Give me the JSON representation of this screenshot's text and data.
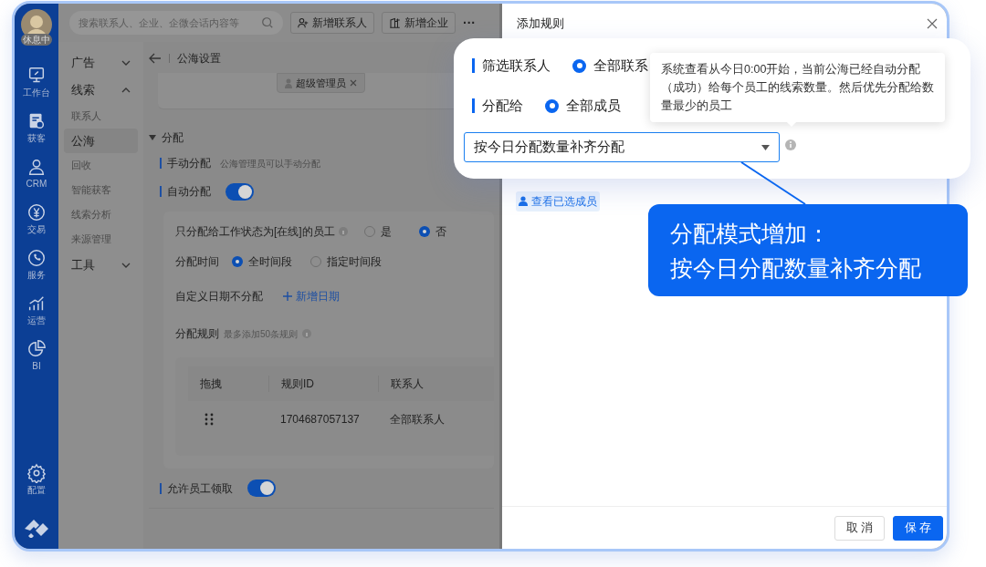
{
  "avatar": {
    "status": "休息中"
  },
  "rail": [
    {
      "kind": "workbench",
      "label": "工作台"
    },
    {
      "kind": "acquire",
      "label": "获客"
    },
    {
      "kind": "crm",
      "label": "CRM"
    },
    {
      "kind": "trade",
      "label": "交易"
    },
    {
      "kind": "service",
      "label": "服务"
    },
    {
      "kind": "ops",
      "label": "运营"
    },
    {
      "kind": "bi",
      "label": "BI"
    },
    {
      "kind": "config",
      "label": "配置"
    }
  ],
  "search": {
    "placeholder": "搜索联系人、企业、企微会话内容等"
  },
  "top_buttons": [
    {
      "kind": "contact",
      "label": "新增联系人"
    },
    {
      "kind": "company",
      "label": "新增企业"
    }
  ],
  "more": "···",
  "nav": [
    {
      "label": "广告",
      "expanded": false
    },
    {
      "label": "线索",
      "expanded": true,
      "children": [
        {
          "label": "联系人",
          "selected": false
        },
        {
          "label": "公海",
          "selected": true
        },
        {
          "label": "回收",
          "selected": false
        },
        {
          "label": "智能获客",
          "selected": false
        },
        {
          "label": "线索分析",
          "selected": false
        },
        {
          "label": "来源管理",
          "selected": false
        }
      ]
    },
    {
      "label": "工具",
      "expanded": false
    }
  ],
  "page": {
    "title": "公海设置",
    "tag": "超级管理员"
  },
  "section": {
    "title": "分配",
    "expanded": true
  },
  "manual": {
    "label": "手动分配",
    "hint": "公海管理员可以手动分配"
  },
  "auto": {
    "label": "自动分配",
    "on": true
  },
  "online_only": {
    "label": "只分配给工作状态为[在线]的员工",
    "options": [
      {
        "label": "是",
        "selected": false
      },
      {
        "label": "否",
        "selected": true
      }
    ]
  },
  "time": {
    "label": "分配时间",
    "options": [
      {
        "label": "全时间段",
        "selected": true
      },
      {
        "label": "指定时间段",
        "selected": false
      }
    ]
  },
  "custom_date": {
    "label": "自定义日期不分配",
    "link": "新增日期"
  },
  "rules": {
    "label": "分配规则",
    "hint": "最多添加50条规则"
  },
  "table": {
    "columns": [
      "拖拽",
      "规则ID",
      "联系人"
    ],
    "rows": [
      {
        "id": "1704687057137",
        "contacts": "全部联系人"
      }
    ]
  },
  "allow_claim": {
    "label": "允许员工领取",
    "on": true
  },
  "drawer": {
    "title": "添加规则",
    "view_members": "查看已选成员",
    "buttons": [
      {
        "kind": "secondary",
        "label": "取 消"
      },
      {
        "kind": "primary",
        "label": "保 存"
      }
    ]
  },
  "zoom": {
    "filter": {
      "label": "筛选联系人",
      "option": "全部联系",
      "selected": true
    },
    "assign": {
      "label": "分配给",
      "option": "全部成员",
      "selected": true
    },
    "mode": {
      "value": "按今日分配数量补齐分配"
    },
    "tooltip": "系统查看从今日0:00开始，当前公海已经自动分配（成功）给每个员工的线索数量。然后优先分配给数量最少的员工"
  },
  "callout": {
    "lines": [
      "分配模式增加：",
      "按今日分配数量补齐分配"
    ]
  }
}
